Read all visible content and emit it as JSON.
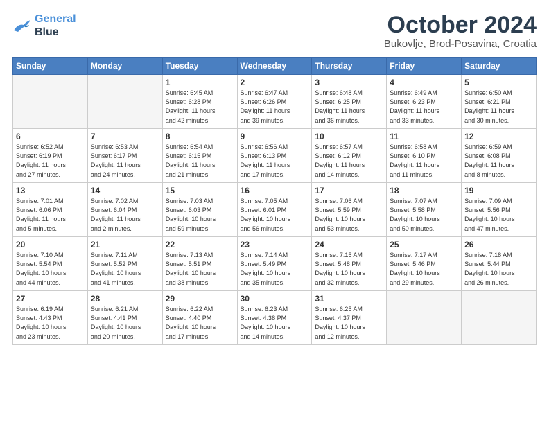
{
  "header": {
    "logo_line1": "General",
    "logo_line2": "Blue",
    "month": "October 2024",
    "location": "Bukovlje, Brod-Posavina, Croatia"
  },
  "days_of_week": [
    "Sunday",
    "Monday",
    "Tuesday",
    "Wednesday",
    "Thursday",
    "Friday",
    "Saturday"
  ],
  "weeks": [
    [
      {
        "day": "",
        "info": ""
      },
      {
        "day": "",
        "info": ""
      },
      {
        "day": "1",
        "info": "Sunrise: 6:45 AM\nSunset: 6:28 PM\nDaylight: 11 hours\nand 42 minutes."
      },
      {
        "day": "2",
        "info": "Sunrise: 6:47 AM\nSunset: 6:26 PM\nDaylight: 11 hours\nand 39 minutes."
      },
      {
        "day": "3",
        "info": "Sunrise: 6:48 AM\nSunset: 6:25 PM\nDaylight: 11 hours\nand 36 minutes."
      },
      {
        "day": "4",
        "info": "Sunrise: 6:49 AM\nSunset: 6:23 PM\nDaylight: 11 hours\nand 33 minutes."
      },
      {
        "day": "5",
        "info": "Sunrise: 6:50 AM\nSunset: 6:21 PM\nDaylight: 11 hours\nand 30 minutes."
      }
    ],
    [
      {
        "day": "6",
        "info": "Sunrise: 6:52 AM\nSunset: 6:19 PM\nDaylight: 11 hours\nand 27 minutes."
      },
      {
        "day": "7",
        "info": "Sunrise: 6:53 AM\nSunset: 6:17 PM\nDaylight: 11 hours\nand 24 minutes."
      },
      {
        "day": "8",
        "info": "Sunrise: 6:54 AM\nSunset: 6:15 PM\nDaylight: 11 hours\nand 21 minutes."
      },
      {
        "day": "9",
        "info": "Sunrise: 6:56 AM\nSunset: 6:13 PM\nDaylight: 11 hours\nand 17 minutes."
      },
      {
        "day": "10",
        "info": "Sunrise: 6:57 AM\nSunset: 6:12 PM\nDaylight: 11 hours\nand 14 minutes."
      },
      {
        "day": "11",
        "info": "Sunrise: 6:58 AM\nSunset: 6:10 PM\nDaylight: 11 hours\nand 11 minutes."
      },
      {
        "day": "12",
        "info": "Sunrise: 6:59 AM\nSunset: 6:08 PM\nDaylight: 11 hours\nand 8 minutes."
      }
    ],
    [
      {
        "day": "13",
        "info": "Sunrise: 7:01 AM\nSunset: 6:06 PM\nDaylight: 11 hours\nand 5 minutes."
      },
      {
        "day": "14",
        "info": "Sunrise: 7:02 AM\nSunset: 6:04 PM\nDaylight: 11 hours\nand 2 minutes."
      },
      {
        "day": "15",
        "info": "Sunrise: 7:03 AM\nSunset: 6:03 PM\nDaylight: 10 hours\nand 59 minutes."
      },
      {
        "day": "16",
        "info": "Sunrise: 7:05 AM\nSunset: 6:01 PM\nDaylight: 10 hours\nand 56 minutes."
      },
      {
        "day": "17",
        "info": "Sunrise: 7:06 AM\nSunset: 5:59 PM\nDaylight: 10 hours\nand 53 minutes."
      },
      {
        "day": "18",
        "info": "Sunrise: 7:07 AM\nSunset: 5:58 PM\nDaylight: 10 hours\nand 50 minutes."
      },
      {
        "day": "19",
        "info": "Sunrise: 7:09 AM\nSunset: 5:56 PM\nDaylight: 10 hours\nand 47 minutes."
      }
    ],
    [
      {
        "day": "20",
        "info": "Sunrise: 7:10 AM\nSunset: 5:54 PM\nDaylight: 10 hours\nand 44 minutes."
      },
      {
        "day": "21",
        "info": "Sunrise: 7:11 AM\nSunset: 5:52 PM\nDaylight: 10 hours\nand 41 minutes."
      },
      {
        "day": "22",
        "info": "Sunrise: 7:13 AM\nSunset: 5:51 PM\nDaylight: 10 hours\nand 38 minutes."
      },
      {
        "day": "23",
        "info": "Sunrise: 7:14 AM\nSunset: 5:49 PM\nDaylight: 10 hours\nand 35 minutes."
      },
      {
        "day": "24",
        "info": "Sunrise: 7:15 AM\nSunset: 5:48 PM\nDaylight: 10 hours\nand 32 minutes."
      },
      {
        "day": "25",
        "info": "Sunrise: 7:17 AM\nSunset: 5:46 PM\nDaylight: 10 hours\nand 29 minutes."
      },
      {
        "day": "26",
        "info": "Sunrise: 7:18 AM\nSunset: 5:44 PM\nDaylight: 10 hours\nand 26 minutes."
      }
    ],
    [
      {
        "day": "27",
        "info": "Sunrise: 6:19 AM\nSunset: 4:43 PM\nDaylight: 10 hours\nand 23 minutes."
      },
      {
        "day": "28",
        "info": "Sunrise: 6:21 AM\nSunset: 4:41 PM\nDaylight: 10 hours\nand 20 minutes."
      },
      {
        "day": "29",
        "info": "Sunrise: 6:22 AM\nSunset: 4:40 PM\nDaylight: 10 hours\nand 17 minutes."
      },
      {
        "day": "30",
        "info": "Sunrise: 6:23 AM\nSunset: 4:38 PM\nDaylight: 10 hours\nand 14 minutes."
      },
      {
        "day": "31",
        "info": "Sunrise: 6:25 AM\nSunset: 4:37 PM\nDaylight: 10 hours\nand 12 minutes."
      },
      {
        "day": "",
        "info": ""
      },
      {
        "day": "",
        "info": ""
      }
    ]
  ]
}
